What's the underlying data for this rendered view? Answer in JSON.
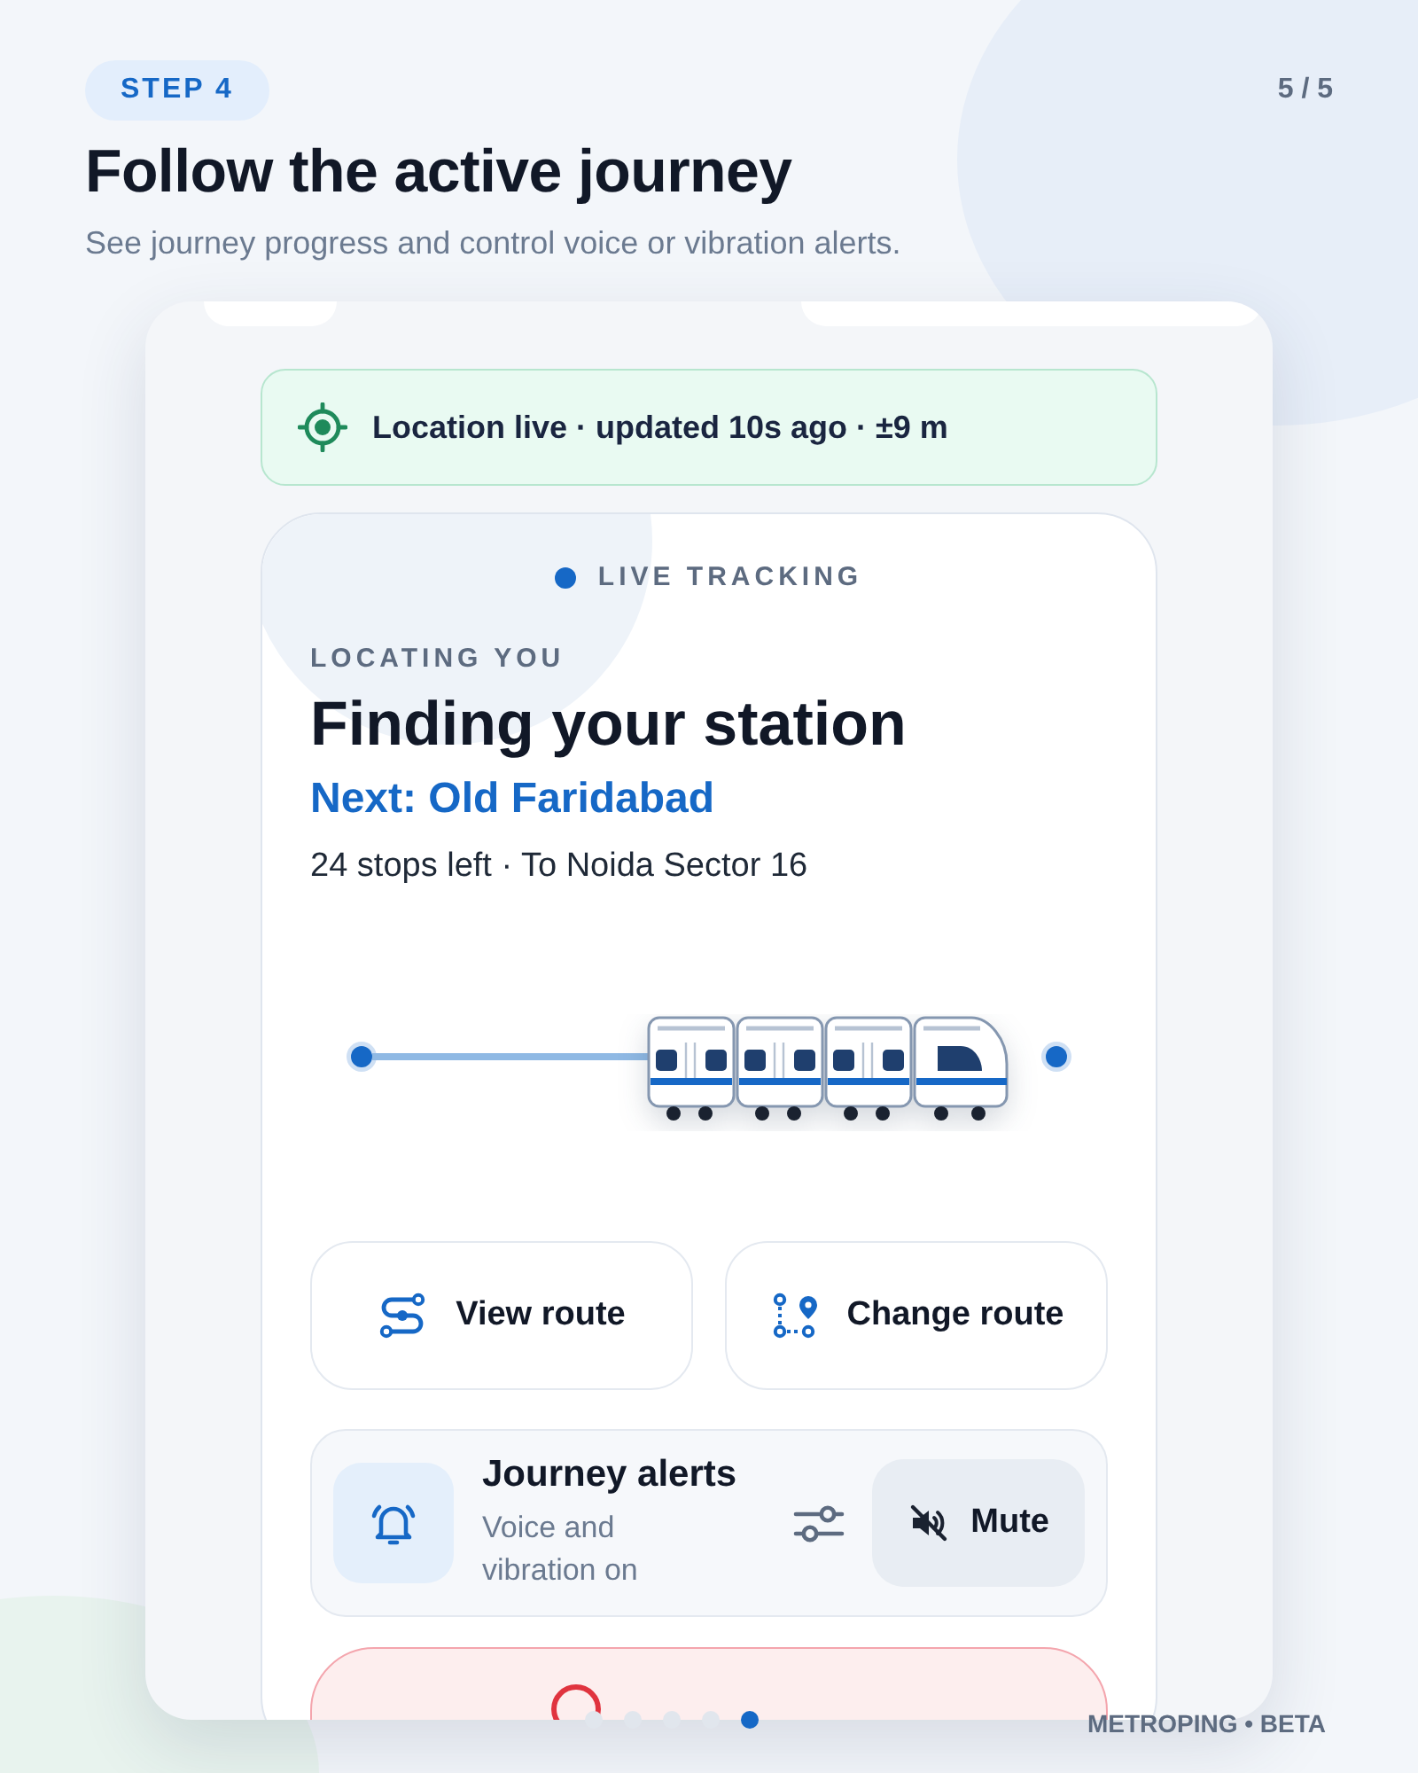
{
  "step": {
    "label": "STEP 4"
  },
  "page_counter": "5 / 5",
  "title": "Follow the active journey",
  "subtitle": "See journey progress and control voice or vibration alerts.",
  "location_banner": {
    "text": "Location live · updated 10s ago · ±9 m"
  },
  "tracking_card": {
    "badge": "LIVE TRACKING",
    "eyebrow": "LOCATING YOU",
    "heading": "Finding your station",
    "next_station": "Next: Old Faridabad",
    "details": "24 stops left · To Noida Sector 16"
  },
  "actions": [
    {
      "kind": "view",
      "label": "View route"
    },
    {
      "kind": "change",
      "label": "Change route"
    }
  ],
  "alerts": {
    "title": "Journey alerts",
    "status": "Voice and vibration on",
    "mute_label": "Mute"
  },
  "pagination": [
    {
      "selected": false
    },
    {
      "selected": false
    },
    {
      "selected": false
    },
    {
      "selected": false
    },
    {
      "selected": true
    }
  ],
  "brand": "METROPING • BETA"
}
